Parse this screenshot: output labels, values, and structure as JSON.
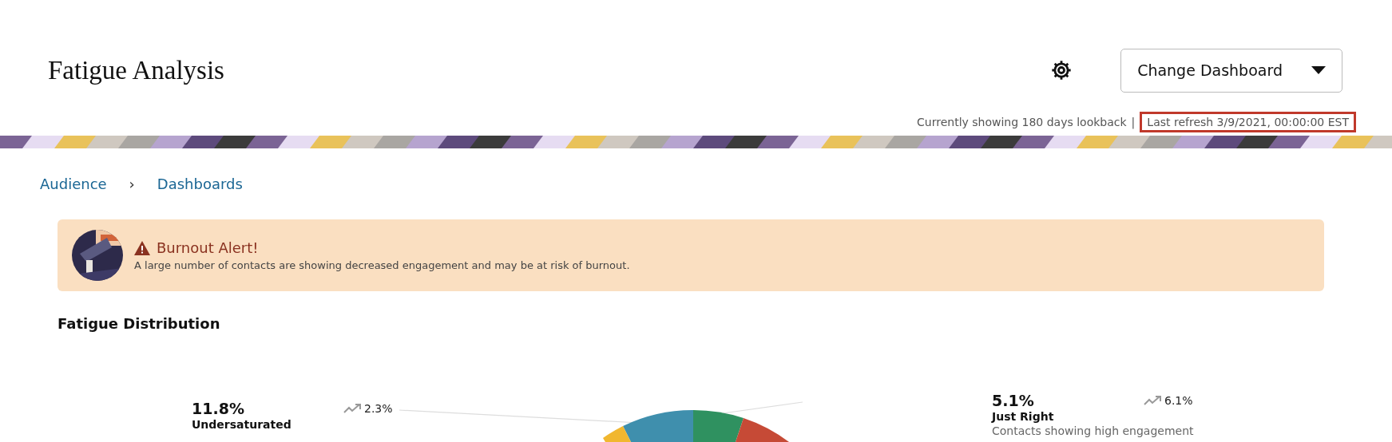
{
  "header": {
    "title": "Fatigue Analysis",
    "button": "Change Dashboard",
    "lookback": "Currently showing 180 days lookback",
    "separator": "|",
    "refresh": "Last refresh 3/9/2021, 00:00:00 EST",
    "refresh_highlighted": true
  },
  "breadcrumb": [
    {
      "label": "Audience"
    },
    {
      "label": "Dashboards"
    }
  ],
  "breadcrumb_separator": "›",
  "alert": {
    "title": "Burnout Alert!",
    "message": "A large number of contacts are showing decreased engagement and may be at risk of burnout."
  },
  "section": {
    "title": "Fatigue Distribution"
  },
  "segments": [
    {
      "percent": "11.8%",
      "trend": "2.3%",
      "name": "Undersaturated"
    },
    {
      "percent": "5.1%",
      "trend": "6.1%",
      "name": "Just Right",
      "description": "Contacts showing high engagement"
    }
  ]
}
